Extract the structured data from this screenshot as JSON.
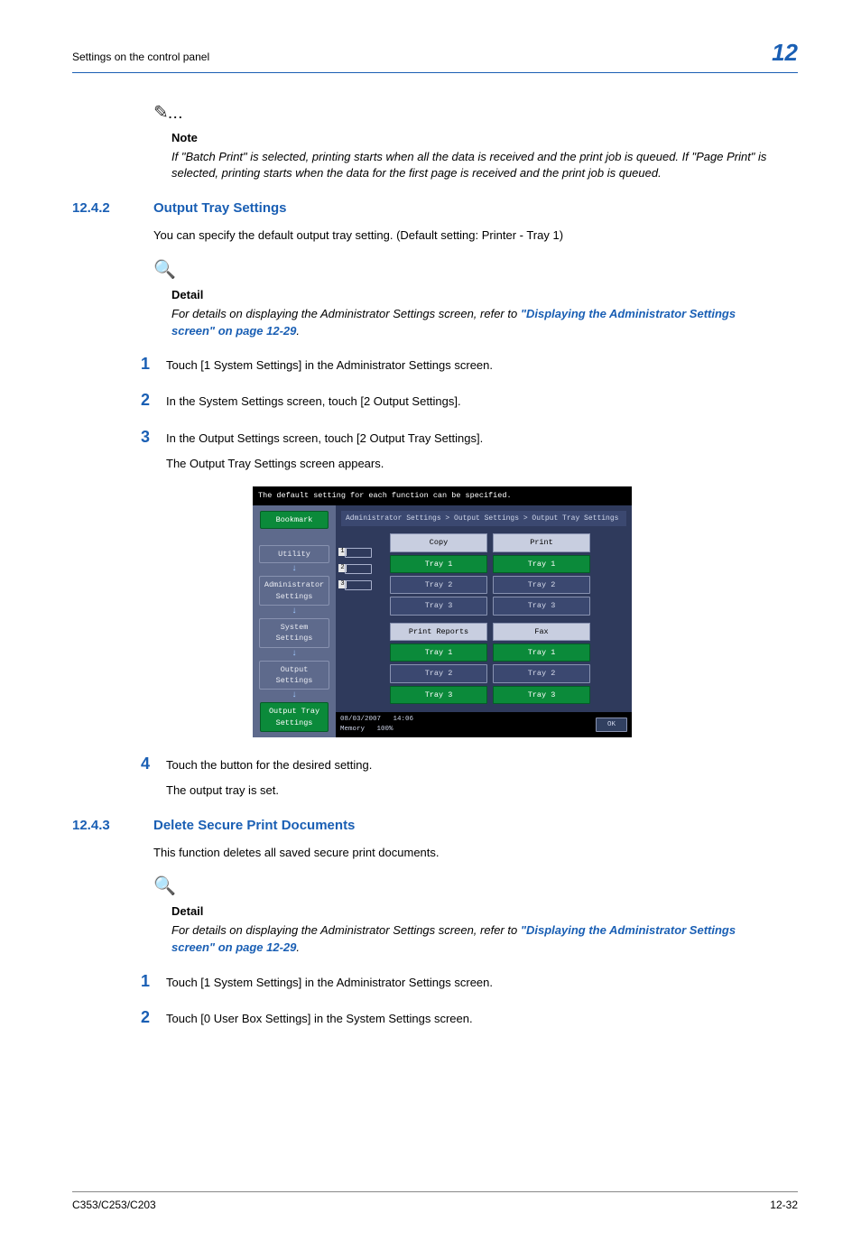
{
  "header": {
    "left": "Settings on the control panel",
    "chapter": "12"
  },
  "note1": {
    "title": "Note",
    "body": "If \"Batch Print\" is selected, printing starts when all the data is received and the print job is queued. If \"Page Print\" is selected, printing starts when the data for the first page is received and the print job is queued."
  },
  "sec1": {
    "num": "12.4.2",
    "title": "Output Tray Settings",
    "intro": "You can specify the default output tray setting. (Default setting: Printer - Tray 1)"
  },
  "detail1": {
    "title": "Detail",
    "pre": "For details on displaying the Administrator Settings screen, refer to ",
    "link": "\"Displaying the Administrator Settings screen\" on page 12-29",
    "post": "."
  },
  "steps_a": {
    "s1": "Touch [1 System Settings] in the Administrator Settings screen.",
    "s2": "In the System Settings screen, touch [2 Output Settings].",
    "s3": "In the Output Settings screen, touch [2 Output Tray Settings].",
    "s3_after": "The Output Tray Settings screen appears."
  },
  "screenshot": {
    "prompt": "The default setting for each function can be specified.",
    "crumb": "Administrator Settings > Output Settings > Output Tray Settings",
    "side": {
      "bookmark": "Bookmark",
      "utility": "Utility",
      "admin": "Administrator Settings",
      "system": "System Settings",
      "output": "Output Settings",
      "tray": "Output Tray Settings"
    },
    "cols": {
      "copy": "Copy",
      "print": "Print",
      "reports": "Print Reports",
      "fax": "Fax"
    },
    "opts": {
      "t1": "Tray 1",
      "t2": "Tray 2",
      "t3": "Tray 3"
    },
    "status": {
      "date": "08/03/2007",
      "time": "14:06",
      "memlabel": "Memory",
      "memval": "100%",
      "ok": "OK"
    }
  },
  "steps_a2": {
    "s4": "Touch the button for the desired setting.",
    "s4_after": "The output tray is set."
  },
  "sec2": {
    "num": "12.4.3",
    "title": "Delete Secure Print Documents",
    "intro": "This function deletes all saved secure print documents."
  },
  "detail2": {
    "title": "Detail",
    "pre": "For details on displaying the Administrator Settings screen, refer to ",
    "link": "\"Displaying the Administrator Settings screen\" on page 12-29",
    "post": "."
  },
  "steps_b": {
    "s1": "Touch [1 System Settings] in the Administrator Settings screen.",
    "s2": "Touch [0 User Box Settings] in the System Settings screen."
  },
  "footer": {
    "left": "C353/C253/C203",
    "right": "12-32"
  }
}
